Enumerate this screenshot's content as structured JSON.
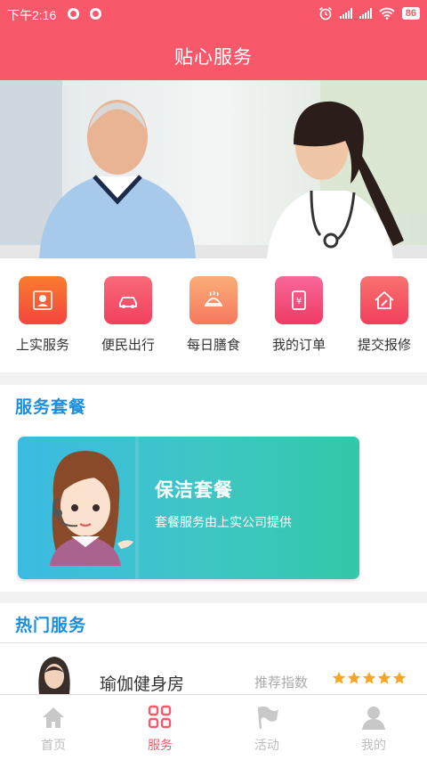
{
  "status_bar": {
    "time": "下午2:16",
    "battery": "86"
  },
  "header": {
    "title": "贴心服务"
  },
  "banner": {
    "pages": 3,
    "active_index": 0
  },
  "quick_actions": [
    {
      "label": "上实服务",
      "icon": "person-icon",
      "color": "#f65a3f"
    },
    {
      "label": "便民出行",
      "icon": "car-icon",
      "color": "#f5566e"
    },
    {
      "label": "每日膳食",
      "icon": "food-tray-icon",
      "color": "#f88e6a"
    },
    {
      "label": "我的订单",
      "icon": "order-icon",
      "color": "#f4567a"
    },
    {
      "label": "提交报修",
      "icon": "repair-house-icon",
      "color": "#f4586c"
    }
  ],
  "packages": {
    "section_title": "服务套餐",
    "card": {
      "title": "保洁套餐",
      "subtitle": "套餐服务由上实公司提供"
    }
  },
  "hot": {
    "section_title": "热门服务",
    "items": [
      {
        "name": "瑜伽健身房",
        "rec_label": "推荐指数",
        "rating": 5
      }
    ]
  },
  "tabbar": {
    "tabs": [
      {
        "label": "首页",
        "icon": "home-icon"
      },
      {
        "label": "服务",
        "icon": "grid-icon"
      },
      {
        "label": "活动",
        "icon": "flag-icon"
      },
      {
        "label": "我的",
        "icon": "user-icon"
      }
    ],
    "active": 1
  },
  "colors": {
    "brand": "#f8586a",
    "section_title": "#1c8ee0",
    "star": "#f5a623"
  }
}
